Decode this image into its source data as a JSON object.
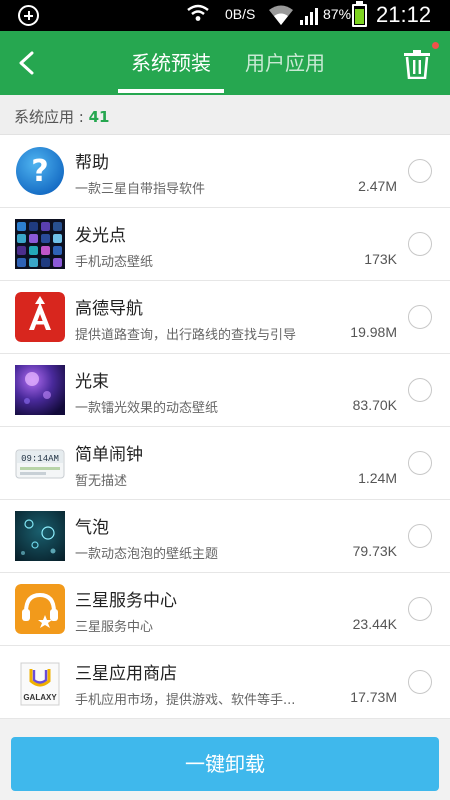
{
  "status_bar": {
    "net_rate": "0B/S",
    "battery_percent": "87%",
    "battery_level": 0.87,
    "time": "21:12",
    "icons": [
      "add-icon",
      "wifi-icon",
      "wifi-icon",
      "signal-icon",
      "battery-icon"
    ]
  },
  "header": {
    "tabs": [
      {
        "label": "系统预装",
        "active": true
      },
      {
        "label": "用户应用",
        "active": false
      }
    ],
    "back_icon": "chevron-left-icon",
    "trash_icon": "trash-icon"
  },
  "summary": {
    "label": "系统应用 : ",
    "count": "41"
  },
  "apps": [
    {
      "name": "帮助",
      "desc": "一款三星自带指导软件",
      "size": "2.47M",
      "icon": "help-icon",
      "selected": false
    },
    {
      "name": "发光点",
      "desc": "手机动态壁纸",
      "size": "173K",
      "icon": "glow-dots-icon",
      "selected": false
    },
    {
      "name": "高德导航",
      "desc": "提供道路查询，出行路线的查找与引导",
      "size": "19.98M",
      "icon": "amap-navigation-icon",
      "selected": false
    },
    {
      "name": "光束",
      "desc": "一款镭光效果的动态壁纸",
      "size": "83.70K",
      "icon": "light-beam-icon",
      "selected": false
    },
    {
      "name": "简单闹钟",
      "desc": "暂无描述",
      "size": "1.24M",
      "icon": "alarm-clock-icon",
      "selected": false,
      "icon_text": "09:14AM"
    },
    {
      "name": "气泡",
      "desc": "一款动态泡泡的壁纸主题",
      "size": "79.73K",
      "icon": "bubbles-icon",
      "selected": false
    },
    {
      "name": "三星服务中心",
      "desc": "三星服务中心",
      "size": "23.44K",
      "icon": "headset-service-icon",
      "selected": false
    },
    {
      "name": "三星应用商店",
      "desc": "手机应用市场，提供游戏、软件等手...",
      "size": "17.73M",
      "icon": "galaxy-store-icon",
      "selected": false,
      "icon_text": "GALAXY"
    }
  ],
  "footer": {
    "uninstall_label": "一键卸载"
  },
  "colors": {
    "accent_green": "#26a750",
    "button_blue": "#3fb8ec",
    "notify_red": "#f0514a"
  }
}
